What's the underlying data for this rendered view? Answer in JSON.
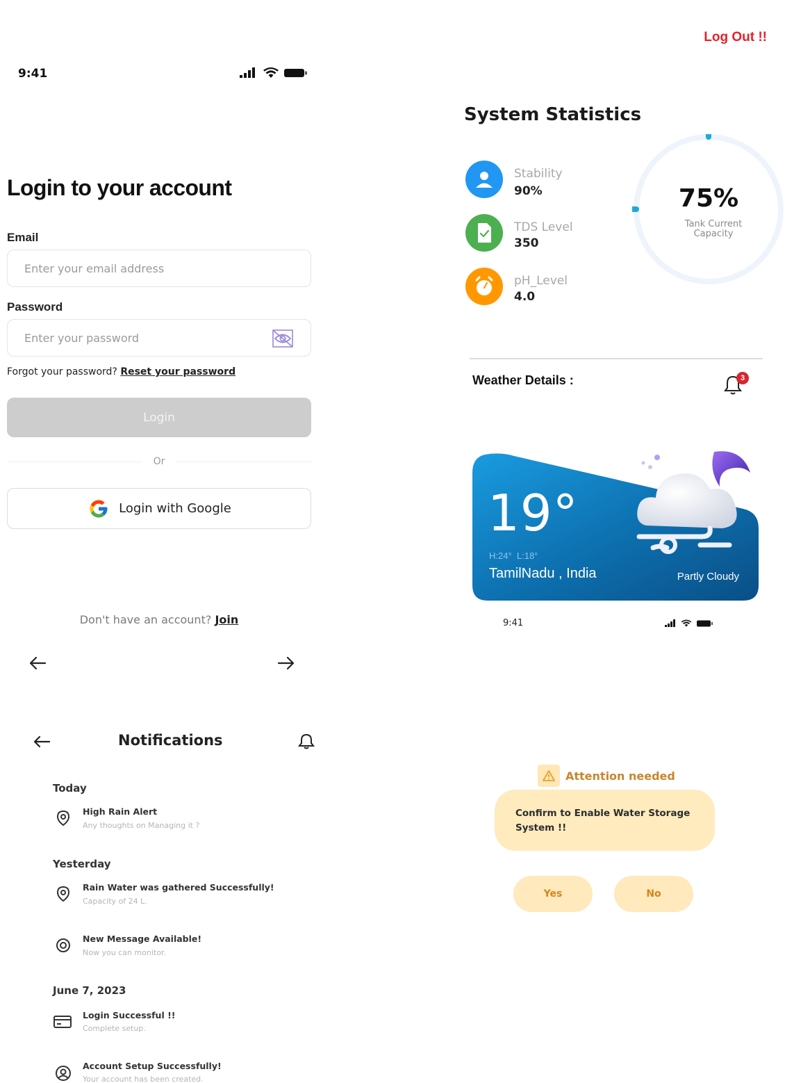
{
  "header": {
    "logout_label": "Log Out !!"
  },
  "login_status_bar": {
    "time": "9:41"
  },
  "login": {
    "title": "Login to your account",
    "email_label": "Email",
    "email_placeholder": "Enter your email address",
    "password_label": "Password",
    "password_placeholder": "Enter your password",
    "forgot_text": "Forgot your password?",
    "reset_link": "Reset your password",
    "login_button": "Login",
    "or_text": "Or",
    "google_button": "Login with Google",
    "no_account_text": "Don't have an account?",
    "join_link": "Join"
  },
  "stats": {
    "title": "System Statistics",
    "items": [
      {
        "label": "Stability",
        "value": "90%",
        "icon": "user-icon",
        "color": "#2196f3"
      },
      {
        "label": "TDS Level",
        "value": "350",
        "icon": "document-check-icon",
        "color": "#4caf50"
      },
      {
        "label": "pH_Level",
        "value": "4.0",
        "icon": "timer-icon",
        "color": "#ff9800"
      }
    ],
    "gauge": {
      "value_text": "75%",
      "value": 75,
      "label": "Tank Current Capacity",
      "color": "#1eaad6"
    }
  },
  "weather": {
    "title": "Weather Details :",
    "notification_count": "3",
    "temperature": "19°",
    "high_low": "H:24°  L:18°",
    "location": "TamilNadu , India",
    "condition": "Partly Cloudy",
    "status_time": "9:41"
  },
  "notifications": {
    "title": "Notifications",
    "groups": [
      {
        "label": "Today",
        "items": [
          {
            "title": "High Rain Alert",
            "subtitle": "Any thoughts on Managing it ?",
            "icon": "location-pin-icon"
          }
        ]
      },
      {
        "label": "Yesterday",
        "items": [
          {
            "title": "Rain Water was gathered Successfully!",
            "subtitle": "Capacity of 24 L.",
            "icon": "location-pin-icon"
          },
          {
            "title": "New Message Available!",
            "subtitle": "Now you can monitor.",
            "icon": "message-icon"
          }
        ]
      },
      {
        "label": "June 7, 2023",
        "items": [
          {
            "title": "Login Successful !!",
            "subtitle": "Complete setup.",
            "icon": "card-icon"
          },
          {
            "title": "Account Setup Successfully!",
            "subtitle": "Your account has been created.",
            "icon": "account-icon"
          }
        ]
      }
    ]
  },
  "attention": {
    "badge": "Attention needed",
    "message_line1": "Confirm to Enable Water Storage",
    "message_line2": "System !!",
    "yes_label": "Yes",
    "no_label": "No"
  }
}
